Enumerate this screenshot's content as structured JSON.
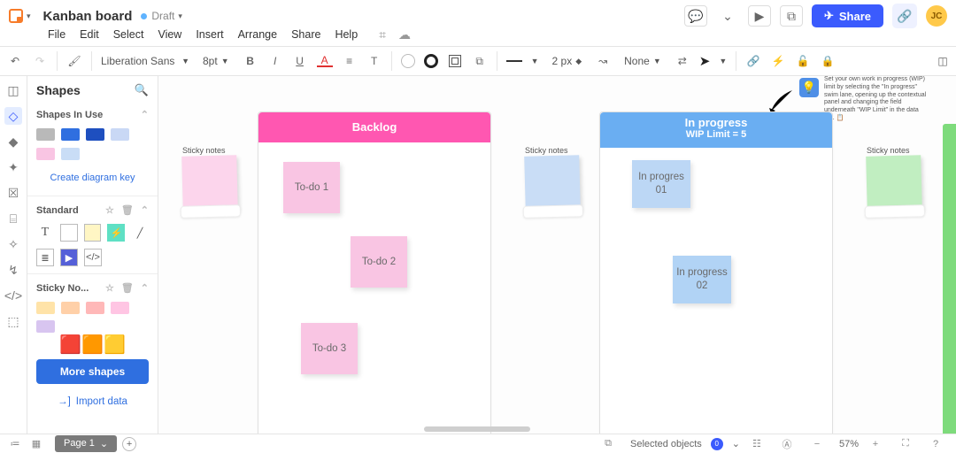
{
  "header": {
    "doc_title": "Kanban board",
    "draft_label": "Draft",
    "share_label": "Share",
    "avatar_initials": "JC"
  },
  "menu": {
    "items": [
      "File",
      "Edit",
      "Select",
      "View",
      "Insert",
      "Arrange",
      "Share",
      "Help"
    ]
  },
  "toolbar": {
    "font_name": "Liberation Sans",
    "font_size": "8pt",
    "line_width": "2 px",
    "line_style": "None"
  },
  "shapes_panel": {
    "title": "Shapes",
    "in_use": "Shapes In Use",
    "create_key": "Create diagram key",
    "standard": "Standard",
    "sticky": "Sticky No...",
    "more": "More shapes",
    "import": "Import data",
    "swatches_in_use": [
      "#b9b9b9",
      "#2f6fe0",
      "#1e4fbf",
      "#c9d8f5",
      "#f9c5e3",
      "#c9ddf6"
    ],
    "sticky_swatches": [
      "#ffe3a8",
      "#ffd0a8",
      "#ffb8b8",
      "#ffc5e3",
      "#d8c5f0"
    ]
  },
  "canvas": {
    "backlog": {
      "title": "Backlog",
      "notes": [
        "To-do 1",
        "To-do 2",
        "To-do 3"
      ]
    },
    "inprogress": {
      "title": "In progress",
      "subtitle": "WIP Limit = 5",
      "notes": [
        "In progres 01",
        "In progress 02"
      ]
    },
    "sticky_groups": {
      "label": "Sticky notes"
    },
    "tip": "Set your own work in progress (WIP) limit by selecting the \"In progress\" swim lane, opening up the contextual panel and changing the field underneath \"WIP Limit\" in the data tab. 📋"
  },
  "bottom": {
    "page_label": "Page 1",
    "selected_label": "Selected objects",
    "selected_count": "0",
    "zoom": "57%"
  }
}
